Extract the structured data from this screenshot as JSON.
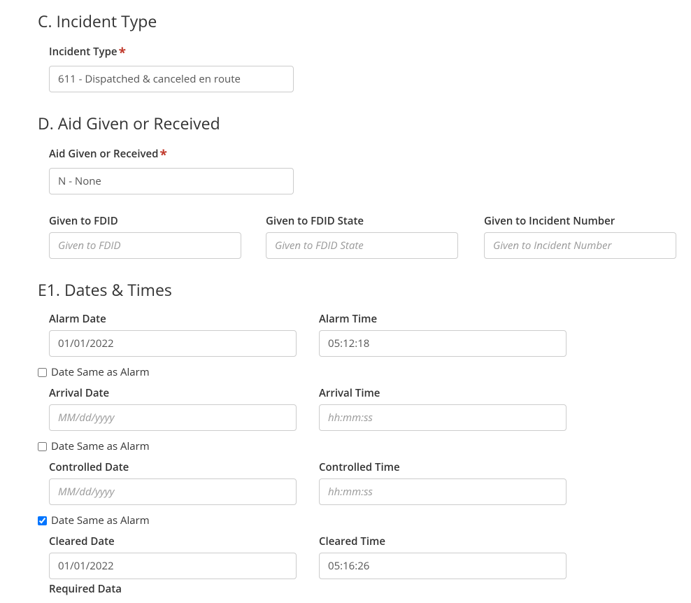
{
  "sectionC": {
    "heading": "C. Incident Type",
    "incidentType": {
      "label": "Incident Type",
      "value": "611 - Dispatched & canceled en route"
    }
  },
  "sectionD": {
    "heading": "D. Aid Given or Received",
    "aid": {
      "label": "Aid Given or Received",
      "value": "N - None"
    },
    "givenToFDID": {
      "label": "Given to FDID",
      "placeholder": "Given to FDID",
      "value": ""
    },
    "givenToFDIDState": {
      "label": "Given to FDID State",
      "placeholder": "Given to FDID State",
      "value": ""
    },
    "givenToIncidentNumber": {
      "label": "Given to Incident Number",
      "placeholder": "Given to Incident Number",
      "value": ""
    }
  },
  "sectionE1": {
    "heading": "E1. Dates & Times",
    "dateSameAsAlarmLabel": "Date Same as Alarm",
    "alarmDate": {
      "label": "Alarm Date",
      "value": "01/01/2022"
    },
    "alarmTime": {
      "label": "Alarm Time",
      "value": "05:12:18"
    },
    "arrivalSameAsAlarm": false,
    "arrivalDate": {
      "label": "Arrival Date",
      "placeholder": "MM/dd/yyyy",
      "value": ""
    },
    "arrivalTime": {
      "label": "Arrival Time",
      "placeholder": "hh:mm:ss",
      "value": ""
    },
    "controlledSameAsAlarm": false,
    "controlledDate": {
      "label": "Controlled Date",
      "placeholder": "MM/dd/yyyy",
      "value": ""
    },
    "controlledTime": {
      "label": "Controlled Time",
      "placeholder": "hh:mm:ss",
      "value": ""
    },
    "clearedSameAsAlarm": true,
    "clearedDate": {
      "label": "Cleared Date",
      "value": "01/01/2022"
    },
    "clearedTime": {
      "label": "Cleared Time",
      "value": "05:16:26"
    },
    "requiredDataNote": "Required Data"
  }
}
